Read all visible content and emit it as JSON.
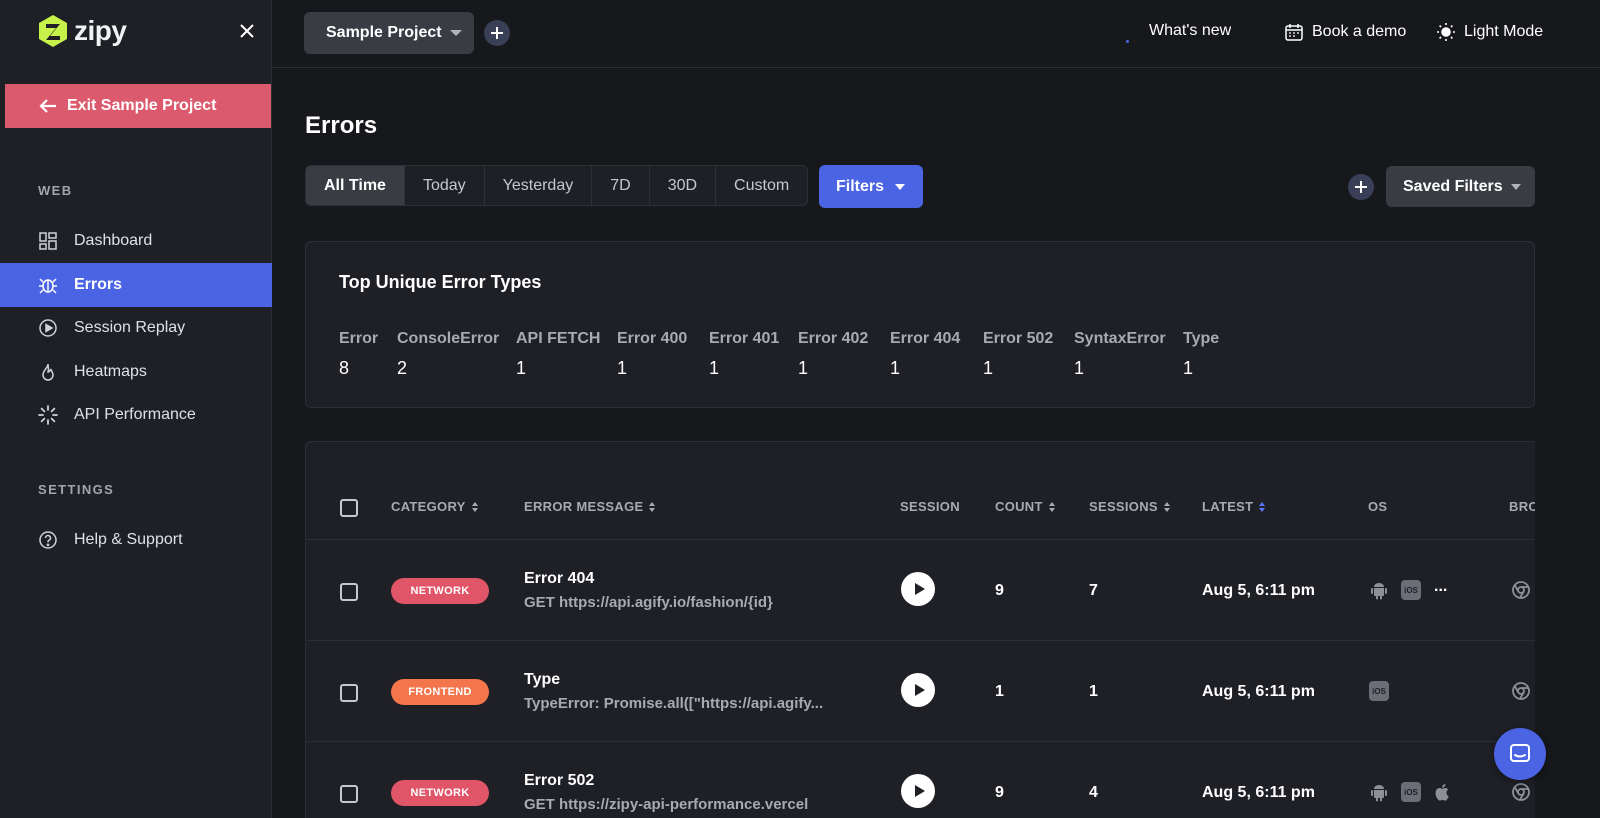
{
  "brand": {
    "name": "zipy"
  },
  "sidebar": {
    "exit_label": "Exit Sample Project",
    "section_web": "WEB",
    "section_settings": "SETTINGS",
    "items": [
      {
        "label": "Dashboard",
        "icon": "dashboard-icon"
      },
      {
        "label": "Errors",
        "icon": "bug-icon",
        "active": true
      },
      {
        "label": "Session Replay",
        "icon": "play-circle-icon"
      },
      {
        "label": "Heatmaps",
        "icon": "flame-icon"
      },
      {
        "label": "API Performance",
        "icon": "spinner-icon"
      }
    ],
    "settings_items": [
      {
        "label": "Help & Support",
        "icon": "help-icon"
      }
    ]
  },
  "topbar": {
    "project": "Sample Project",
    "whats_new": "What's new",
    "book_demo": "Book a demo",
    "light_mode": "Light Mode"
  },
  "page": {
    "title": "Errors",
    "time_filters": [
      "All Time",
      "Today",
      "Yesterday",
      "7D",
      "30D",
      "Custom"
    ],
    "active_time_filter": "All Time",
    "filters_label": "Filters",
    "saved_filters_label": "Saved Filters"
  },
  "top_types": {
    "title": "Top Unique Error Types",
    "items": [
      {
        "name": "Error",
        "count": "8"
      },
      {
        "name": "ConsoleError",
        "count": "2"
      },
      {
        "name": "API FETCH",
        "count": "1"
      },
      {
        "name": "Error 400",
        "count": "1"
      },
      {
        "name": "Error 401",
        "count": "1"
      },
      {
        "name": "Error 402",
        "count": "1"
      },
      {
        "name": "Error 404",
        "count": "1"
      },
      {
        "name": "Error 502",
        "count": "1"
      },
      {
        "name": "SyntaxError",
        "count": "1"
      },
      {
        "name": "Type",
        "count": "1"
      }
    ]
  },
  "table": {
    "headers": {
      "category": "CATEGORY",
      "message": "ERROR MESSAGE",
      "session": "SESSION",
      "count": "COUNT",
      "sessions": "SESSIONS",
      "latest": "LATEST",
      "os": "OS",
      "browser": "BRO"
    },
    "rows": [
      {
        "category": "NETWORK",
        "title": "Error 404",
        "subtitle": "GET https://api.agify.io/fashion/{id}",
        "count": "9",
        "sessions": "7",
        "latest": "Aug 5, 6:11 pm",
        "os": [
          "android",
          "ios"
        ],
        "os_more": "...",
        "browser": "chrome"
      },
      {
        "category": "FRONTEND",
        "title": "Type",
        "subtitle": "TypeError: Promise.all([\"https://api.agify...",
        "count": "1",
        "sessions": "1",
        "latest": "Aug 5, 6:11 pm",
        "os": [
          "ios"
        ],
        "browser": "chrome"
      },
      {
        "category": "NETWORK",
        "title": "Error 502",
        "subtitle": "GET https://zipy-api-performance.vercel",
        "count": "9",
        "sessions": "4",
        "latest": "Aug 5, 6:11 pm",
        "os": [
          "android",
          "ios",
          "apple"
        ],
        "browser": "chrome"
      }
    ]
  },
  "colors": {
    "accent": "#4a64e4",
    "network": "#e15568",
    "frontend": "#f2754b",
    "exit": "#dc5a6d"
  }
}
